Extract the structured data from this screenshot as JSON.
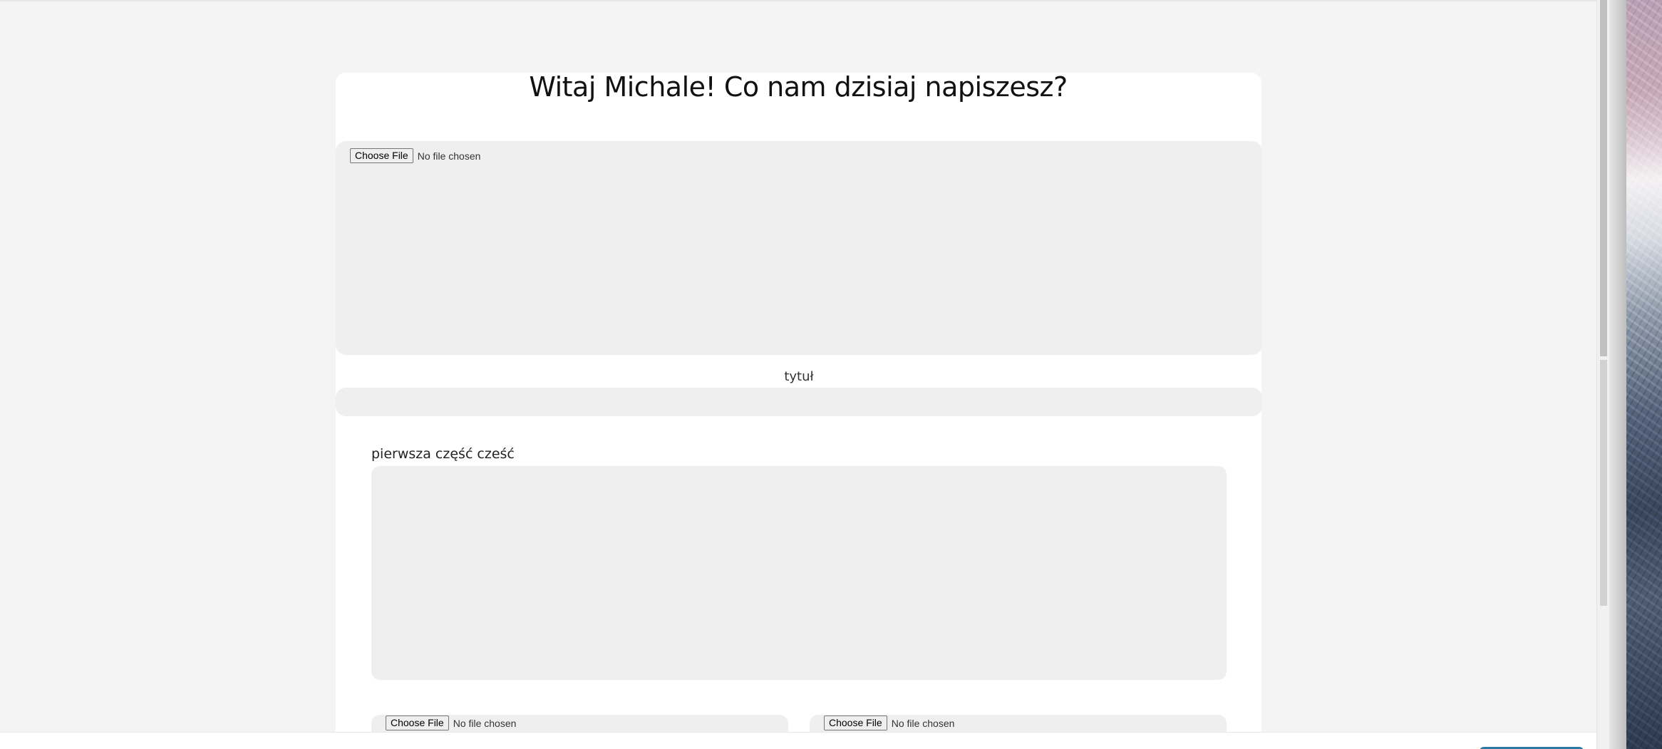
{
  "page": {
    "greeting": "Witaj Michale! Co nam dzisiaj napiszesz?"
  },
  "main_image_upload": {
    "button_label": "Choose File",
    "status": "No file chosen"
  },
  "title_field": {
    "label": "tytuł",
    "value": ""
  },
  "first_section": {
    "label": "pierwsza część cześć",
    "value": ""
  },
  "section_uploads": [
    {
      "button_label": "Choose File",
      "status": "No file chosen"
    },
    {
      "button_label": "Choose File",
      "status": "No file chosen"
    }
  ],
  "colors": {
    "background": "#f4f4f4",
    "card": "#ffffff",
    "field": "#efefef",
    "accent": "#2a7aa3"
  }
}
